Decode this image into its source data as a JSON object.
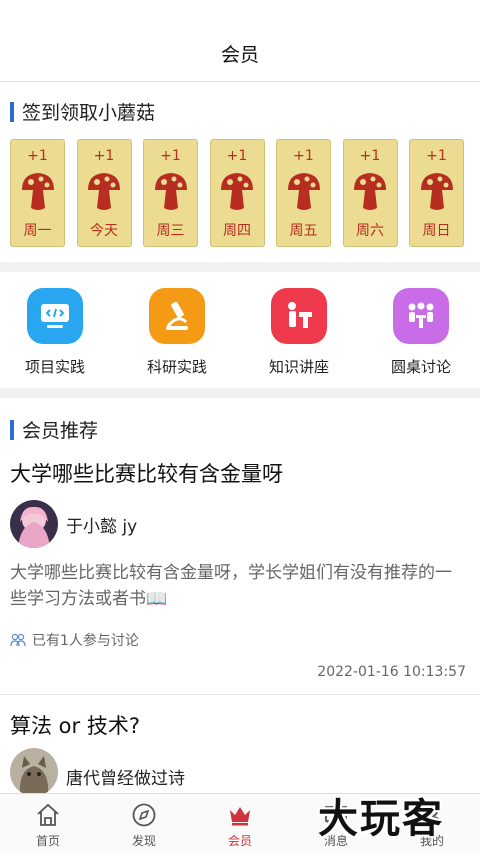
{
  "header": {
    "title": "会员"
  },
  "checkin": {
    "title": "签到领取小蘑菇",
    "days": [
      {
        "plus": "+1",
        "label": "周一"
      },
      {
        "plus": "+1",
        "label": "今天"
      },
      {
        "plus": "+1",
        "label": "周三"
      },
      {
        "plus": "+1",
        "label": "周四"
      },
      {
        "plus": "+1",
        "label": "周五"
      },
      {
        "plus": "+1",
        "label": "周六"
      },
      {
        "plus": "+1",
        "label": "周日"
      }
    ],
    "icon": "mushroom-icon",
    "colors": {
      "card": "#ecdc92",
      "text": "#b72d1f"
    }
  },
  "features": [
    {
      "label": "项目实践",
      "icon": "code-icon",
      "color": "#29a6f0"
    },
    {
      "label": "科研实践",
      "icon": "microscope-icon",
      "color": "#f59a14"
    },
    {
      "label": "知识讲座",
      "icon": "lecture-icon",
      "color": "#ee3a4c"
    },
    {
      "label": "圆桌讨论",
      "icon": "roundtable-icon",
      "color": "#c96ce8"
    }
  ],
  "recommend": {
    "title": "会员推荐",
    "post": {
      "title": "大学哪些比赛比较有含金量呀",
      "author": "于小懿 jy",
      "body": "大学哪些比赛比较有含金量呀，学长学姐们有没有推荐的一些学习方法或者书📖",
      "participants": "已有1人参与讨论",
      "date": "2022-01-16 10:13:57"
    },
    "post2": {
      "title": "算法 or 技术?",
      "author": "唐代曾经做过诗"
    }
  },
  "tabbar": {
    "tabs": [
      {
        "label": "首页",
        "icon": "home-icon"
      },
      {
        "label": "发现",
        "icon": "compass-icon"
      },
      {
        "label": "会员",
        "icon": "crown-icon"
      },
      {
        "label": "消息",
        "icon": "message-icon"
      },
      {
        "label": "我的",
        "icon": "profile-icon"
      }
    ],
    "active_color": "#d0333b"
  },
  "watermark": "大玩客"
}
